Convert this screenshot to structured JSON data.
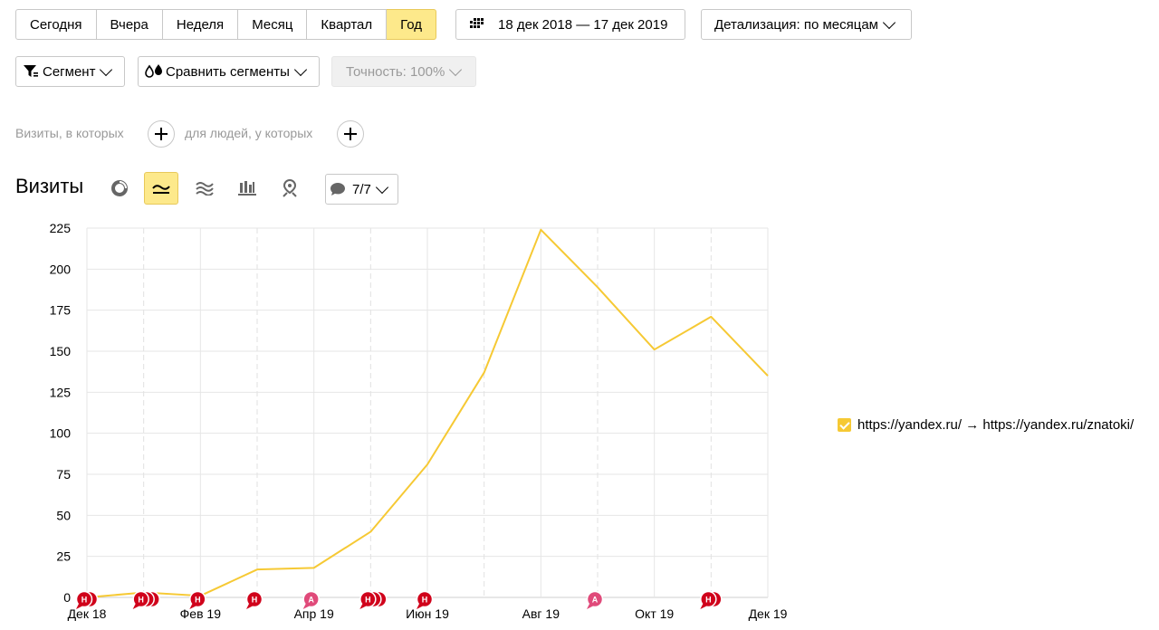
{
  "periods": {
    "today": "Сегодня",
    "yesterday": "Вчера",
    "week": "Неделя",
    "month": "Месяц",
    "quarter": "Квартал",
    "year": "Год"
  },
  "date_range": "18 дек 2018 — 17 дек 2019",
  "detail": "Детализация: по месяцам",
  "segment": "Сегмент",
  "compare": "Сравнить сегменты",
  "accuracy": "Точность: 100%",
  "filter": {
    "visits_label": "Визиты, в которых",
    "people_label": "для людей, у которых"
  },
  "report": {
    "title": "Визиты",
    "notes": "7/7"
  },
  "legend": {
    "series": "https://yandex.ru/ → https://yandex.ru/znatoki/"
  },
  "colors": {
    "accent": "#fde98b",
    "line": "#f6c934",
    "note_red": "#d0021b",
    "note_pink": "#e04a7a"
  },
  "chart_data": {
    "type": "line",
    "title": "",
    "xlabel": "",
    "ylabel": "",
    "ylim": [
      0,
      225
    ],
    "yticks": [
      "0",
      "25",
      "50",
      "75",
      "100",
      "125",
      "150",
      "175",
      "200",
      "225"
    ],
    "xticks": [
      "Дек 18",
      "Фев 19",
      "Апр 19",
      "Июн 19",
      "Авг 19",
      "Окт 19",
      "Дек 19"
    ],
    "x": [
      "Дек 18",
      "Янв 19",
      "Фев 19",
      "Мар 19",
      "Апр 19",
      "Май 19",
      "Июн 19",
      "Июл 19",
      "Авг 19",
      "Сен 19",
      "Окт 19",
      "Ноя 19",
      "Дек 19"
    ],
    "series": [
      {
        "name": "https://yandex.ru/ → https://yandex.ru/znatoki/",
        "values": [
          0,
          3,
          1,
          17,
          18,
          40,
          81,
          137,
          224,
          189,
          151,
          171,
          135
        ]
      }
    ],
    "grid": true,
    "legend_position": "right",
    "notes": [
      {
        "month": "Дек 18",
        "letter": "Н",
        "count": 2,
        "kind": "red"
      },
      {
        "month": "Янв 19",
        "letter": "Н",
        "count": 3,
        "kind": "red"
      },
      {
        "month": "Фев 19",
        "letter": "Н",
        "count": 1,
        "kind": "red"
      },
      {
        "month": "Мар 19",
        "letter": "Н",
        "count": 1,
        "kind": "red"
      },
      {
        "month": "Апр 19",
        "letter": "А",
        "count": 1,
        "kind": "pink"
      },
      {
        "month": "Май 19",
        "letter": "Н",
        "count": 3,
        "kind": "red"
      },
      {
        "month": "Июн 19",
        "letter": "Н",
        "count": 1,
        "kind": "red"
      },
      {
        "month": "Сен 19",
        "letter": "А",
        "count": 1,
        "kind": "pink"
      },
      {
        "month": "Ноя 19",
        "letter": "Н",
        "count": 2,
        "kind": "red"
      }
    ]
  }
}
